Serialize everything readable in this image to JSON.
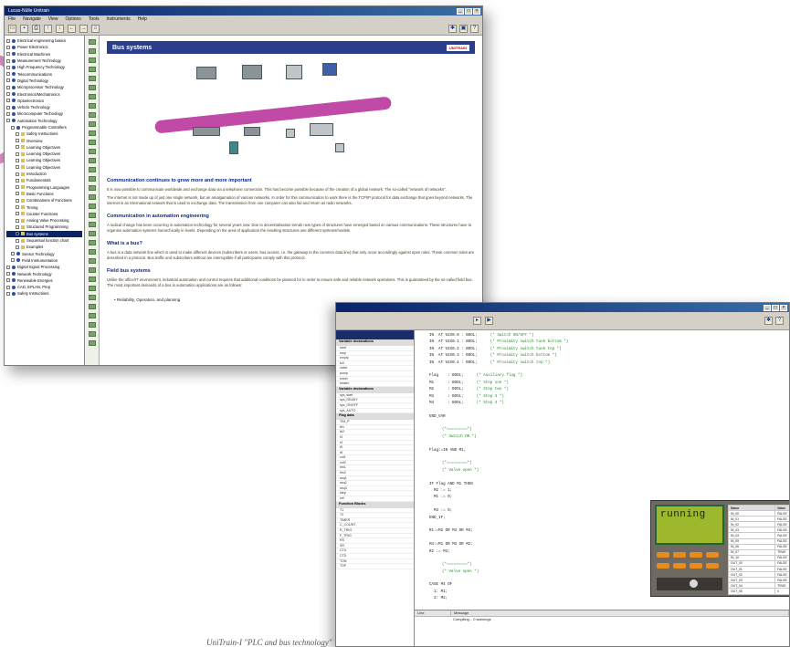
{
  "help_window": {
    "title": "Lucas-Nülle Unitrain",
    "menu": [
      "File",
      "Navigate",
      "View",
      "Options",
      "Tools",
      "Instruments",
      "Help"
    ],
    "tree": [
      {
        "label": "Electrical engineering basics",
        "level": 0
      },
      {
        "label": "Power Electronics",
        "level": 0
      },
      {
        "label": "Electrical Machines",
        "level": 0
      },
      {
        "label": "Measurement Technology",
        "level": 0
      },
      {
        "label": "High Frequency Technology",
        "level": 0
      },
      {
        "label": "Telecommunications",
        "level": 0
      },
      {
        "label": "Digital Technology",
        "level": 0
      },
      {
        "label": "Microprocessor Technology",
        "level": 0
      },
      {
        "label": "Electronics/Mechatronics",
        "level": 0
      },
      {
        "label": "Optoelectronics",
        "level": 0
      },
      {
        "label": "Vehicle Technology",
        "level": 0
      },
      {
        "label": "Microcomputer Technology",
        "level": 0
      },
      {
        "label": "Automation Technology",
        "level": 0
      },
      {
        "label": "Programmable Controllers",
        "level": 1
      },
      {
        "label": "Safety Instructions",
        "level": 2
      },
      {
        "label": "Overview",
        "level": 2
      },
      {
        "label": "Learning Objectives",
        "level": 2
      },
      {
        "label": "Learning Objectives",
        "level": 2
      },
      {
        "label": "Learning Objectives",
        "level": 2
      },
      {
        "label": "Learning Objectives",
        "level": 2
      },
      {
        "label": "Introduction",
        "level": 2
      },
      {
        "label": "Fundamentals",
        "level": 2
      },
      {
        "label": "Programming Languages",
        "level": 2
      },
      {
        "label": "Basic Functions",
        "level": 2
      },
      {
        "label": "Combinations of Functions",
        "level": 2
      },
      {
        "label": "Timing",
        "level": 2
      },
      {
        "label": "Counter Functions",
        "level": 2
      },
      {
        "label": "Analog Value Processing",
        "level": 2
      },
      {
        "label": "Structured Programming",
        "level": 2
      },
      {
        "label": "Bus systems",
        "level": 2
      },
      {
        "label": "Sequential function chart",
        "level": 2
      },
      {
        "label": "Examples",
        "level": 2
      },
      {
        "label": "Sensor Technology",
        "level": 1
      },
      {
        "label": "Field Instrumentation",
        "level": 1
      },
      {
        "label": "Digital Signal Processing",
        "level": 0
      },
      {
        "label": "Network Technology",
        "level": 0
      },
      {
        "label": "Renewable Energies",
        "level": 0
      },
      {
        "label": "CAD, EPLAN, Prep",
        "level": 0
      },
      {
        "label": "Safety Instructions",
        "level": 0
      }
    ],
    "selected_index": 29,
    "page": {
      "banner_title": "Bus systems",
      "logo_text": "UNITRAIN",
      "sections": [
        {
          "heading": "Communication continues to grow more and more important",
          "paragraphs": [
            "It is now possible to communicate worldwide and exchange data via a telephone connection. This has become possible because of the creation of a global network. The so-called \"network of networks\".",
            "The internet is not made up of just one single network, but an amalgamation of various networks. In order for this communication to work there is the TCP/IP protocol for data exchange that goes beyond networks. The internet is an international network that is used to exchange data. The transmission from one computer can also fail and return as radio networks."
          ]
        },
        {
          "heading": "Communication in automation engineering",
          "paragraphs": [
            "A radical change has been occurring in automation technology for several years now. Due to decentralisation trends new types of structures have emerged based on various communications. These structures have to organise automation systems hierarchically in levels. Depending on the area of application the resulting structures use different systems/models."
          ]
        },
        {
          "heading": "What is a bus?",
          "paragraphs": [
            "A bus is a data network line which is used to make different devices (subscribers or users, bus access, i.e. the gateway to the common data line) that only occur accordingly against open rules. These common rules are described in a protocol. Bus traffic and subscribers without are interruptible if all participants comply with this protocol."
          ]
        },
        {
          "heading": "Field bus systems",
          "paragraphs": [
            "Unlike the office/IT environment, industrial automation and control requires that additional conditions be planned for in order to ensure safe and reliable network operations. This is guaranteed by the so-called field bus. The most important demands of a bus in automation applications are as follows:"
          ]
        }
      ],
      "bullet": "Reliability, Operation, and planning"
    }
  },
  "ide_window": {
    "declarations": [
      {
        "type": "section",
        "label": "Variable declarations"
      },
      {
        "type": "row",
        "label": "start"
      },
      {
        "type": "row",
        "label": "stop"
      },
      {
        "type": "row",
        "label": "empty"
      },
      {
        "type": "row",
        "label": "full"
      },
      {
        "type": "row",
        "label": "valve"
      },
      {
        "type": "row",
        "label": "pump"
      },
      {
        "type": "row",
        "label": "mixer"
      },
      {
        "type": "row",
        "label": "heater"
      },
      {
        "type": "section",
        "label": "Variable declarations"
      },
      {
        "type": "row",
        "label": "sys_start"
      },
      {
        "type": "row",
        "label": "sys_READY"
      },
      {
        "type": "row",
        "label": "sys_ONOFF"
      },
      {
        "type": "row",
        "label": "sys_AUTO"
      },
      {
        "type": "section",
        "label": "Flag data"
      },
      {
        "type": "row",
        "label": "TIM_P"
      },
      {
        "type": "row",
        "label": "tb1"
      },
      {
        "type": "row",
        "label": "tb2"
      },
      {
        "type": "row",
        "label": "t3"
      },
      {
        "type": "row",
        "label": "t4"
      },
      {
        "type": "row",
        "label": "t5"
      },
      {
        "type": "row",
        "label": "t6"
      },
      {
        "type": "row",
        "label": "cnt1"
      },
      {
        "type": "row",
        "label": "cnt2"
      },
      {
        "type": "row",
        "label": "tim1"
      },
      {
        "type": "row",
        "label": "tim2"
      },
      {
        "type": "row",
        "label": "seq1"
      },
      {
        "type": "row",
        "label": "seq2"
      },
      {
        "type": "row",
        "label": "seq3"
      },
      {
        "type": "row",
        "label": "step"
      },
      {
        "type": "row",
        "label": "init"
      },
      {
        "type": "section",
        "label": "Function Blocks"
      },
      {
        "type": "row",
        "label": "T1"
      },
      {
        "type": "row",
        "label": "T2"
      },
      {
        "type": "row",
        "label": "TIMER"
      },
      {
        "type": "row",
        "label": "C_COUNT"
      },
      {
        "type": "row",
        "label": "R_TRIG"
      },
      {
        "type": "row",
        "label": "F_TRIG"
      },
      {
        "type": "row",
        "label": "RS"
      },
      {
        "type": "row",
        "label": "SR"
      },
      {
        "type": "row",
        "label": "CTU"
      },
      {
        "type": "row",
        "label": "CTD"
      },
      {
        "type": "row",
        "label": "TON"
      },
      {
        "type": "row",
        "label": "TOF"
      }
    ],
    "code": [
      {
        "code": "IN  AT %IX0.0 : BOOL;",
        "comment": "(* Switch ON/OFF *)"
      },
      {
        "code": "IN  AT %IX0.1 : BOOL;",
        "comment": "(* Proximity switch tank bottom *)"
      },
      {
        "code": "IN  AT %IX0.2 : BOOL;",
        "comment": "(* Proximity switch tank top *)"
      },
      {
        "code": "IN  AT %IX0.3 : BOOL;",
        "comment": "(* Proximity switch bottom *)"
      },
      {
        "code": "IN  AT %IX0.4 : BOOL;",
        "comment": "(* Proximity switch top *)"
      },
      {
        "code": "",
        "comment": ""
      },
      {
        "code": "Flag    : BOOL;",
        "comment": "(* Auxiliary flag *)"
      },
      {
        "code": "M1      : BOOL;",
        "comment": "(* Step one *)"
      },
      {
        "code": "M2      : BOOL;",
        "comment": "(* Step two *)"
      },
      {
        "code": "M3      : BOOL;",
        "comment": "(* Step 3 *)"
      },
      {
        "code": "M4      : BOOL;",
        "comment": "(* Step 4 *)"
      },
      {
        "code": "",
        "comment": ""
      },
      {
        "code": "END_VAR",
        "comment": ""
      },
      {
        "code": "",
        "comment": ""
      },
      {
        "code": "",
        "comment": "(*=========*)"
      },
      {
        "code": "",
        "comment": "(* Switch ON *)"
      },
      {
        "code": "",
        "comment": ""
      },
      {
        "code": "Flag:=IN AND M1;",
        "comment": ""
      },
      {
        "code": "",
        "comment": ""
      },
      {
        "code": "",
        "comment": "(*=========*)"
      },
      {
        "code": "",
        "comment": "(* Valve open *)"
      },
      {
        "code": "",
        "comment": ""
      },
      {
        "code": "IF Flag AND M1 THEN",
        "comment": ""
      },
      {
        "code": "  M2 := 1;",
        "comment": ""
      },
      {
        "code": "  M1 := 0;",
        "comment": ""
      },
      {
        "code": "",
        "comment": ""
      },
      {
        "code": "  M3 := 0;",
        "comment": ""
      },
      {
        "code": "END_IF;",
        "comment": ""
      },
      {
        "code": "",
        "comment": ""
      },
      {
        "code": "R1:=M2 OR M3 OR M4;",
        "comment": ""
      },
      {
        "code": "",
        "comment": ""
      },
      {
        "code": "M4:=M1 OR M3 OR M2;",
        "comment": ""
      },
      {
        "code": "R2 := M3;",
        "comment": ""
      },
      {
        "code": "",
        "comment": ""
      },
      {
        "code": "",
        "comment": "(*=========*)"
      },
      {
        "code": "",
        "comment": "(* Valve open *)"
      },
      {
        "code": "",
        "comment": ""
      },
      {
        "code": "CASE M4 OF",
        "comment": ""
      },
      {
        "code": "  1: M1;",
        "comment": ""
      },
      {
        "code": "  2: M2;",
        "comment": ""
      },
      {
        "code": "",
        "comment": ""
      },
      {
        "code": "  3: M3;",
        "comment": ""
      },
      {
        "code": "  4: M4;",
        "comment": ""
      }
    ],
    "plc": {
      "lcd_text": "running",
      "table_headers": [
        "Name",
        "Value"
      ],
      "table_rows": [
        [
          "IN_00",
          "FALSE"
        ],
        [
          "IN_01",
          "FALSE"
        ],
        [
          "IN_02",
          "FALSE"
        ],
        [
          "IN_03",
          "FALSE"
        ],
        [
          "IN_04",
          "FALSE"
        ],
        [
          "IN_05",
          "FALSE"
        ],
        [
          "IN_06",
          "FALSE"
        ],
        [
          "IN_07",
          "TRUE"
        ],
        [
          "IN_10",
          "FALSE"
        ],
        [
          "OUT_00",
          "FALSE"
        ],
        [
          "OUT_01",
          "FALSE"
        ],
        [
          "OUT_02",
          "FALSE"
        ],
        [
          "OUT_03",
          "FALSE"
        ],
        [
          "OUT_04",
          "TRUE"
        ],
        [
          "OUT_05",
          "0"
        ]
      ]
    },
    "messages": {
      "col1": "Line",
      "col2": "Message",
      "row": "Compiling... 0 warnings"
    }
  },
  "caption": "UniTrain-I \"PLC and bus technology\""
}
